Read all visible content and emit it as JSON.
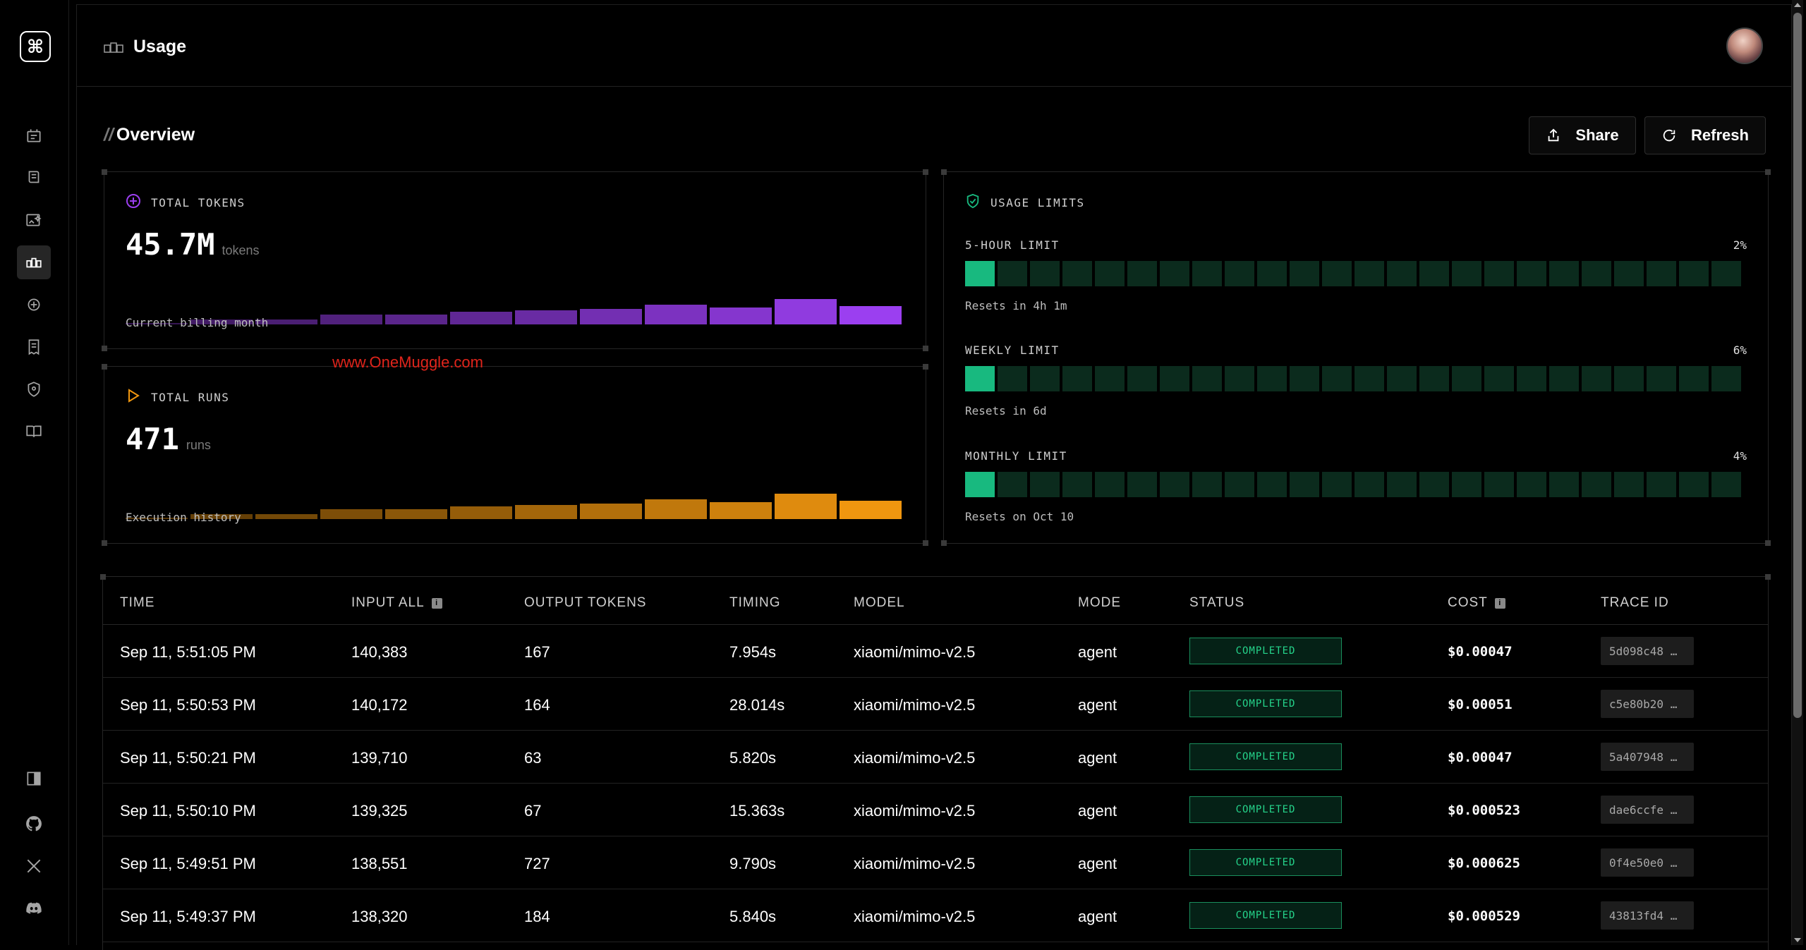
{
  "app": {
    "logo_glyph": "⌘"
  },
  "header": {
    "title": "Usage"
  },
  "overview": {
    "title": "Overview",
    "share_label": "Share",
    "refresh_label": "Refresh"
  },
  "tokens_card": {
    "label": "TOTAL TOKENS",
    "value": "45.7M",
    "unit": "tokens",
    "caption": "Current billing month",
    "color": "#9b3ff0"
  },
  "runs_card": {
    "label": "TOTAL RUNS",
    "value": "471",
    "unit": "runs",
    "caption": "Execution history",
    "color": "#f0960f"
  },
  "limits_card": {
    "label": "USAGE LIMITS",
    "limits": [
      {
        "label": "5-HOUR LIMIT",
        "percent_text": "2%",
        "percent": 2,
        "resets": "Resets in 4h 1m"
      },
      {
        "label": "WEEKLY LIMIT",
        "percent_text": "6%",
        "percent": 6,
        "resets": "Resets in 6d"
      },
      {
        "label": "MONTHLY LIMIT",
        "percent_text": "4%",
        "percent": 4,
        "resets": "Resets on Oct 10"
      }
    ]
  },
  "watermark": "www.OneMuggle.com",
  "table": {
    "headers": {
      "time": "TIME",
      "input": "INPUT ALL",
      "output": "OUTPUT TOKENS",
      "timing": "TIMING",
      "model": "MODEL",
      "mode": "MODE",
      "status": "STATUS",
      "cost": "COST",
      "trace": "TRACE ID"
    },
    "rows": [
      {
        "time": "Sep 11, 5:51:05 PM",
        "input": "140,383",
        "output": "167",
        "timing": "7.954s",
        "model": "xiaomi/mimo-v2.5",
        "mode": "agent",
        "status": "COMPLETED",
        "cost": "$0.00047",
        "trace": "5d098c48 …"
      },
      {
        "time": "Sep 11, 5:50:53 PM",
        "input": "140,172",
        "output": "164",
        "timing": "28.014s",
        "model": "xiaomi/mimo-v2.5",
        "mode": "agent",
        "status": "COMPLETED",
        "cost": "$0.00051",
        "trace": "c5e80b20 …"
      },
      {
        "time": "Sep 11, 5:50:21 PM",
        "input": "139,710",
        "output": "63",
        "timing": "5.820s",
        "model": "xiaomi/mimo-v2.5",
        "mode": "agent",
        "status": "COMPLETED",
        "cost": "$0.00047",
        "trace": "5a407948 …"
      },
      {
        "time": "Sep 11, 5:50:10 PM",
        "input": "139,325",
        "output": "67",
        "timing": "15.363s",
        "model": "xiaomi/mimo-v2.5",
        "mode": "agent",
        "status": "COMPLETED",
        "cost": "$0.000523",
        "trace": "dae6ccfe …"
      },
      {
        "time": "Sep 11, 5:49:51 PM",
        "input": "138,551",
        "output": "727",
        "timing": "9.790s",
        "model": "xiaomi/mimo-v2.5",
        "mode": "agent",
        "status": "COMPLETED",
        "cost": "$0.000625",
        "trace": "0f4e50e0 …"
      },
      {
        "time": "Sep 11, 5:49:37 PM",
        "input": "138,320",
        "output": "184",
        "timing": "5.840s",
        "model": "xiaomi/mimo-v2.5",
        "mode": "agent",
        "status": "COMPLETED",
        "cost": "$0.000529",
        "trace": "43813fd4 …"
      }
    ]
  },
  "colors": {
    "accent_green": "#18b97f",
    "purple": "#9b3ff0",
    "orange": "#f0960f"
  }
}
